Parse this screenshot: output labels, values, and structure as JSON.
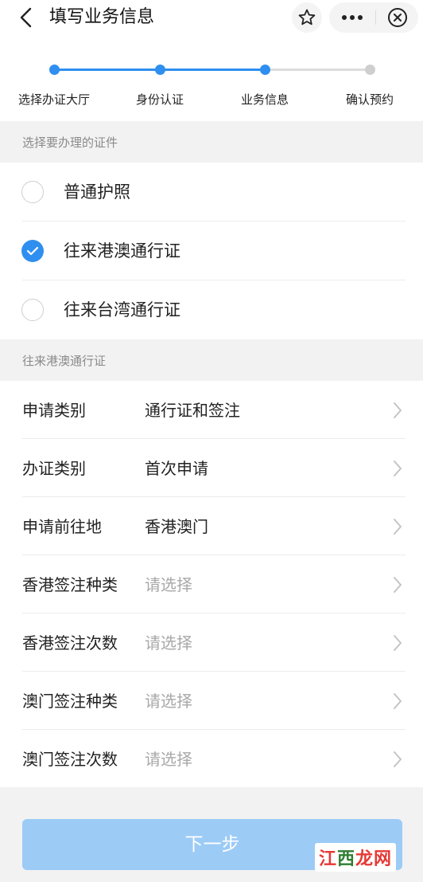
{
  "header": {
    "title": "填写业务信息",
    "back_icon": "chevron-left-icon",
    "star_icon": "star-outline-icon",
    "more_icon": "more-dots-icon",
    "close_icon": "close-circle-icon"
  },
  "stepper": {
    "active_color": "#2f8ff0",
    "inactive_color": "#cfcfcf",
    "current_step": 3,
    "steps": [
      {
        "label": "选择办证大厅",
        "status": "done"
      },
      {
        "label": "身份认证",
        "status": "done"
      },
      {
        "label": "业务信息",
        "status": "current"
      },
      {
        "label": "确认预约",
        "status": "todo"
      }
    ]
  },
  "certificate_section": {
    "title": "选择要办理的证件",
    "options": [
      {
        "label": "普通护照",
        "checked": false
      },
      {
        "label": "往来港澳通行证",
        "checked": true
      },
      {
        "label": "往来台湾通行证",
        "checked": false
      }
    ]
  },
  "details_section": {
    "title": "往来港澳通行证",
    "rows": [
      {
        "label": "申请类别",
        "value": "通行证和签注",
        "is_placeholder": false
      },
      {
        "label": "办证类别",
        "value": "首次申请",
        "is_placeholder": false
      },
      {
        "label": "申请前往地",
        "value": "香港澳门",
        "is_placeholder": false
      },
      {
        "label": "香港签注种类",
        "value": "请选择",
        "is_placeholder": true
      },
      {
        "label": "香港签注次数",
        "value": "请选择",
        "is_placeholder": true
      },
      {
        "label": "澳门签注种类",
        "value": "请选择",
        "is_placeholder": true
      },
      {
        "label": "澳门签注次数",
        "value": "请选择",
        "is_placeholder": true
      }
    ]
  },
  "footer": {
    "next_label": "下一步",
    "next_color": "#9ccbf6"
  },
  "watermark": {
    "part1": "江",
    "part2": "西",
    "part3": "龙网"
  }
}
